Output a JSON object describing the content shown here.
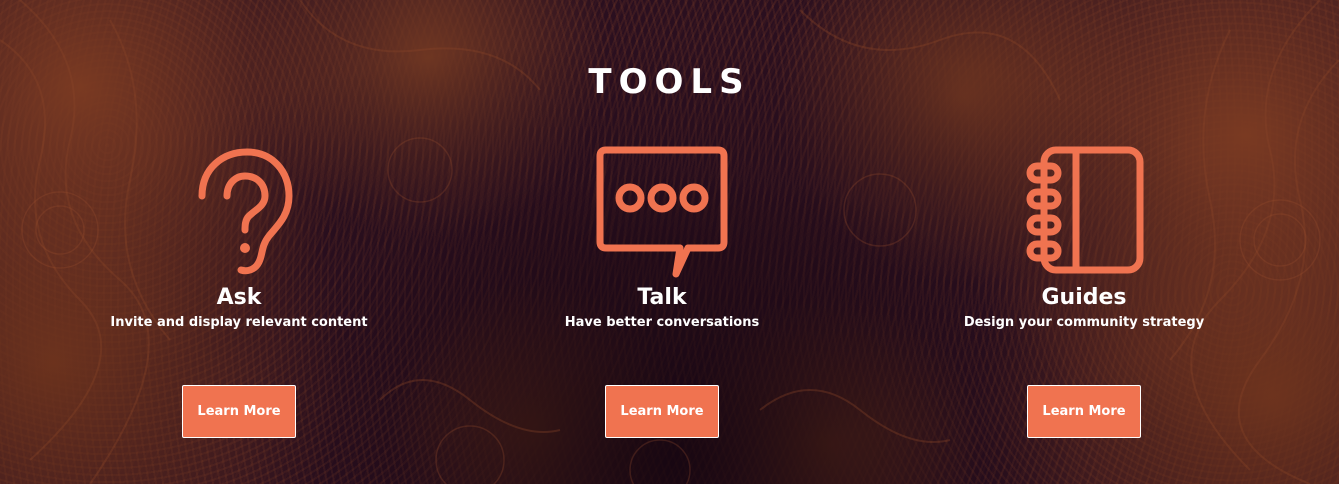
{
  "section": {
    "title": "TOOLS"
  },
  "colors": {
    "accent": "#f07350",
    "background": "#2a0f1f",
    "text": "#ffffff"
  },
  "tools": [
    {
      "name": "Ask",
      "description": "Invite and display relevant content",
      "button_label": "Learn More",
      "icon": "ear-question-icon"
    },
    {
      "name": "Talk",
      "description": "Have better conversations",
      "button_label": "Learn More",
      "icon": "chat-bubble-icon"
    },
    {
      "name": "Guides",
      "description": "Design your community strategy",
      "button_label": "Learn More",
      "icon": "notebook-icon"
    }
  ]
}
